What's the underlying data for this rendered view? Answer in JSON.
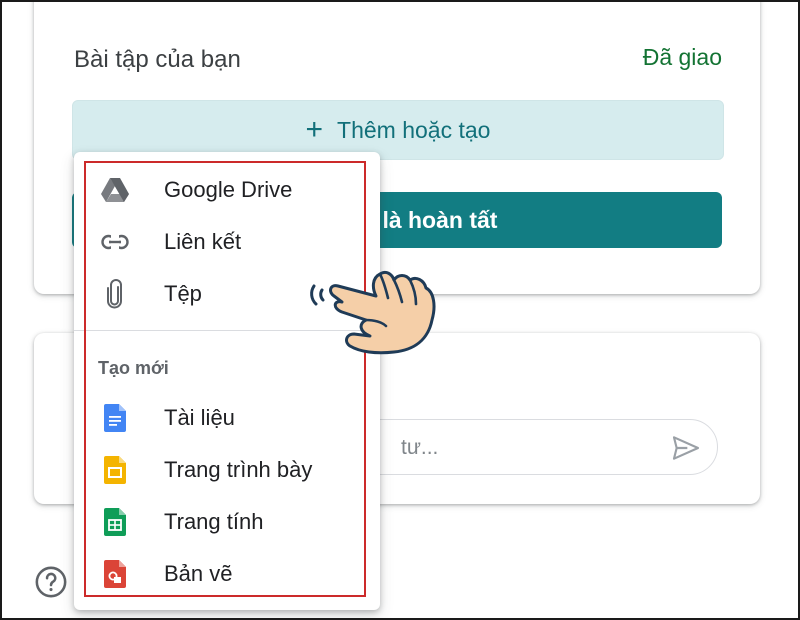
{
  "assignment": {
    "title": "Bài tập của bạn",
    "status": "Đã giao",
    "add_label": "Thêm hoặc tạo",
    "done_label": "u là hoàn tất"
  },
  "comments": {
    "placeholder_visible": "tư..."
  },
  "menu": {
    "attach_items": [
      {
        "label": "Google Drive",
        "icon": "google-drive-icon"
      },
      {
        "label": "Liên kết",
        "icon": "link-icon"
      },
      {
        "label": "Tệp",
        "icon": "paperclip-icon"
      }
    ],
    "create_section": "Tạo mới",
    "create_items": [
      {
        "label": "Tài liệu",
        "icon": "docs-icon"
      },
      {
        "label": "Trang trình bày",
        "icon": "slides-icon"
      },
      {
        "label": "Trang tính",
        "icon": "sheets-icon"
      },
      {
        "label": "Bản vẽ",
        "icon": "drawings-icon"
      }
    ]
  },
  "colors": {
    "teal": "#127d83",
    "status_green": "#137333",
    "highlight_red": "#cc2a2a",
    "docs_blue": "#4285f4",
    "slides_yellow": "#f4b400",
    "sheets_green": "#0f9d58",
    "drawings_red": "#db4437"
  }
}
